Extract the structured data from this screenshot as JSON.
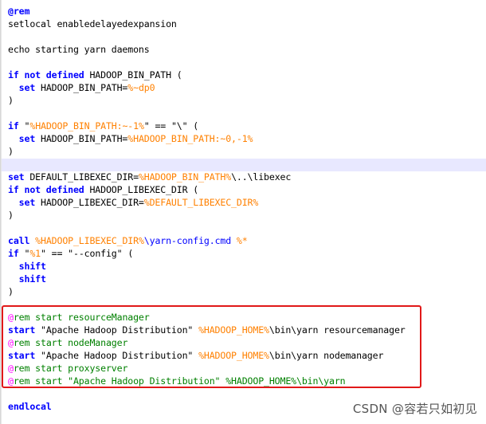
{
  "editor": {
    "lines": [
      [
        {
          "t": "@rem",
          "c": "kw"
        }
      ],
      [
        {
          "t": "setlocal enabledelayedexpansion",
          "c": "default"
        }
      ],
      [],
      [
        {
          "t": "echo starting yarn daemons",
          "c": "default"
        }
      ],
      [],
      [
        {
          "t": "if not defined",
          "c": "kw"
        },
        {
          "t": " HADOOP_BIN_PATH ",
          "c": "default"
        },
        {
          "t": "(",
          "c": "bracket"
        }
      ],
      [
        {
          "t": "  set",
          "c": "kw"
        },
        {
          "t": " HADOOP_BIN_PATH=",
          "c": "default"
        },
        {
          "t": "%~dp0",
          "c": "var"
        }
      ],
      [
        {
          "t": ")",
          "c": "bracket"
        }
      ],
      [],
      [
        {
          "t": "if",
          "c": "kw"
        },
        {
          "t": " ",
          "c": "default"
        },
        {
          "t": "\"",
          "c": "default"
        },
        {
          "t": "%HADOOP_BIN_PATH:~-1%",
          "c": "var"
        },
        {
          "t": "\"",
          "c": "default"
        },
        {
          "t": " == ",
          "c": "op"
        },
        {
          "t": "\"\\\"",
          "c": "default"
        },
        {
          "t": " (",
          "c": "bracket"
        }
      ],
      [
        {
          "t": "  set",
          "c": "kw"
        },
        {
          "t": " HADOOP_BIN_PATH=",
          "c": "default"
        },
        {
          "t": "%HADOOP_BIN_PATH:~0,-1%",
          "c": "var"
        }
      ],
      [
        {
          "t": ")",
          "c": "bracket"
        }
      ],
      [],
      [
        {
          "t": "set",
          "c": "kw"
        },
        {
          "t": " DEFAULT_LIBEXEC_DIR=",
          "c": "default"
        },
        {
          "t": "%HADOOP_BIN_PATH%",
          "c": "var"
        },
        {
          "t": "\\..\\libexec",
          "c": "default"
        }
      ],
      [
        {
          "t": "if not defined",
          "c": "kw"
        },
        {
          "t": " HADOOP_LIBEXEC_DIR ",
          "c": "default"
        },
        {
          "t": "(",
          "c": "bracket"
        }
      ],
      [
        {
          "t": "  set",
          "c": "kw"
        },
        {
          "t": " HADOOP_LIBEXEC_DIR=",
          "c": "default"
        },
        {
          "t": "%DEFAULT_LIBEXEC_DIR%",
          "c": "var"
        }
      ],
      [
        {
          "t": ")",
          "c": "bracket"
        }
      ],
      [],
      [
        {
          "t": "call",
          "c": "kw"
        },
        {
          "t": " ",
          "c": "default"
        },
        {
          "t": "%HADOOP_LIBEXEC_DIR%",
          "c": "var"
        },
        {
          "t": "\\yarn-config.cmd ",
          "c": "blue"
        },
        {
          "t": "%*",
          "c": "var"
        }
      ],
      [
        {
          "t": "if",
          "c": "kw"
        },
        {
          "t": " \"",
          "c": "default"
        },
        {
          "t": "%1",
          "c": "var"
        },
        {
          "t": "\" == ",
          "c": "default"
        },
        {
          "t": "\"--config\"",
          "c": "default"
        },
        {
          "t": " (",
          "c": "bracket"
        }
      ],
      [
        {
          "t": "  shift",
          "c": "kw"
        }
      ],
      [
        {
          "t": "  shift",
          "c": "kw"
        }
      ],
      [
        {
          "t": ")",
          "c": "bracket"
        }
      ],
      [],
      [
        {
          "t": "@",
          "c": "at"
        },
        {
          "t": "rem start resourceManager",
          "c": "comment"
        }
      ],
      [
        {
          "t": "start",
          "c": "kw"
        },
        {
          "t": " \"Apache Hadoop Distribution\" ",
          "c": "default"
        },
        {
          "t": "%HADOOP_HOME%",
          "c": "var"
        },
        {
          "t": "\\bin\\yarn resourcemanager",
          "c": "default"
        }
      ],
      [
        {
          "t": "@",
          "c": "at"
        },
        {
          "t": "rem start nodeManager",
          "c": "comment"
        }
      ],
      [
        {
          "t": "start",
          "c": "kw"
        },
        {
          "t": " \"Apache Hadoop Distribution\" ",
          "c": "default"
        },
        {
          "t": "%HADOOP_HOME%",
          "c": "var"
        },
        {
          "t": "\\bin\\yarn nodemanager",
          "c": "default"
        }
      ],
      [
        {
          "t": "@",
          "c": "at"
        },
        {
          "t": "rem start proxyserver",
          "c": "comment"
        }
      ],
      [
        {
          "t": "@",
          "c": "at"
        },
        {
          "t": "rem start \"Apache Hadoop Distribution\" %HADOOP_HOME%\\bin\\yarn",
          "c": "comment"
        }
      ],
      [],
      [
        {
          "t": "endlocal",
          "c": "kw"
        }
      ]
    ]
  },
  "watermark": {
    "csdn": "CSDN @容若只如初见"
  },
  "colors": {
    "keyword": "#0000ff",
    "variable": "#ff8000",
    "comment": "#008000",
    "comment_at": "#ff00ff",
    "highlight_box": "#e11919",
    "current_line": "#e8e8ff"
  }
}
